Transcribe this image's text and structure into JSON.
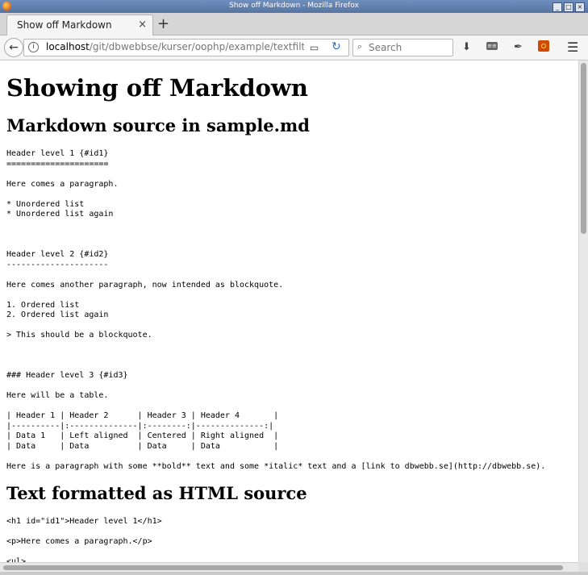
{
  "window": {
    "title": "Show off Markdown - Mozilla Firefox"
  },
  "tab": {
    "label": "Show off Markdown",
    "close": "×",
    "new_tab": "+"
  },
  "nav": {
    "back": "←",
    "url_host": "localhost",
    "url_path": "/git/dbwebbse/kurser/oophp/example/textfilter/f",
    "reload": "↻",
    "search_placeholder": "Search"
  },
  "icons": {
    "info": "i",
    "reader": "▭",
    "search": "⌕",
    "download": "⬇",
    "dev": "≡≡",
    "eyedropper": "✒",
    "menu": "☰"
  },
  "page": {
    "h1": "Showing off Markdown",
    "h2_source": "Markdown source in sample.md",
    "source_lines": "Header level 1 {#id1}\n=====================\n\nHere comes a paragraph.\n\n* Unordered list\n* Unordered list again\n\n\n\nHeader level 2 {#id2}\n---------------------\n\nHere comes another paragraph, now intended as blockquote.\n\n1. Ordered list\n2. Ordered list again\n\n> This should be a blockquote.\n\n\n\n### Header level 3 {#id3}\n\nHere will be a table.\n\n| Header 1 | Header 2      | Header 3 | Header 4       |\n|----------|:--------------|:--------:|--------------:|\n| Data 1   | Left aligned  | Centered | Right aligned  |\n| Data     | Data          | Data     | Data           |\n\nHere is a paragraph with some **bold** text and some *italic* text and a [link to dbwebb.se](http://dbwebb.se).",
    "h2_html": "Text formatted as HTML source",
    "html_lines": "<h1 id=\"id1\">Header level 1</h1>\n\n<p>Here comes a paragraph.</p>\n\n<ul>"
  }
}
